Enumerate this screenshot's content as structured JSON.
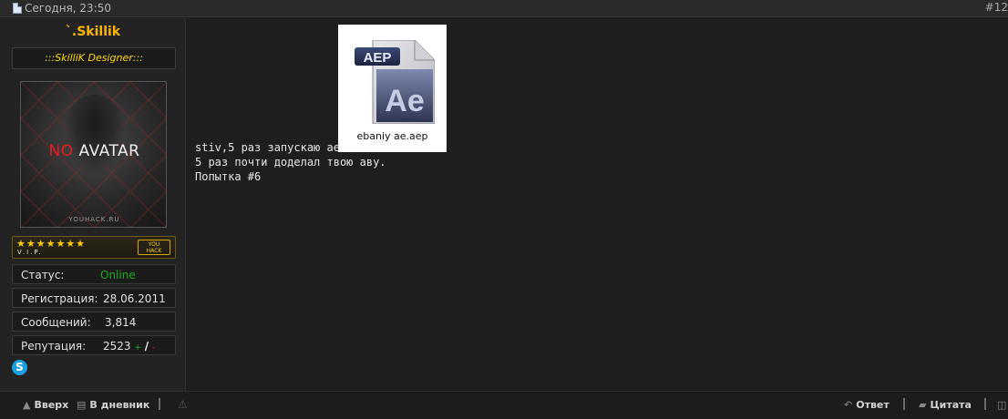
{
  "post": {
    "date": "Сегодня, 23:50",
    "number": "#12"
  },
  "user": {
    "name": "`.Skillik",
    "title": ":::SkilliK Designer:::",
    "avatar": {
      "text_no": "NO",
      "text_avatar": "AVATAR",
      "site": "YOUHACK.RU"
    },
    "badge": {
      "stars": "★★★★★★★",
      "label": "V.I.P.",
      "brand_top": "YOU",
      "brand_bottom": "HACK"
    },
    "stats": [
      {
        "label": "Статус:",
        "value": "Online"
      },
      {
        "label": "Регистрация:",
        "value": "28.06.2011"
      },
      {
        "label": "Сообщений:",
        "value": "3,814"
      },
      {
        "label": "Репутация:",
        "value": "2523",
        "plus": "+",
        "slash": "/",
        "minus": "-"
      }
    ],
    "skype_icon": "S"
  },
  "attachment": {
    "badge": "AEP",
    "logo": "Ae",
    "filename": "ebaniy ae.aep"
  },
  "message": {
    "lines": [
      "stiv,5 раз запускаю ae",
      "5 раз почти доделал твою аву.",
      "Попытка #6"
    ]
  },
  "footer": {
    "up": "Вверх",
    "diary": "В дневник",
    "reply": "Ответ",
    "quote": "Цитата"
  },
  "colors": {
    "username": "#ffb400",
    "usertitle": "#ffd800",
    "online": "#1fa81f",
    "background": "#1e1e1e"
  }
}
